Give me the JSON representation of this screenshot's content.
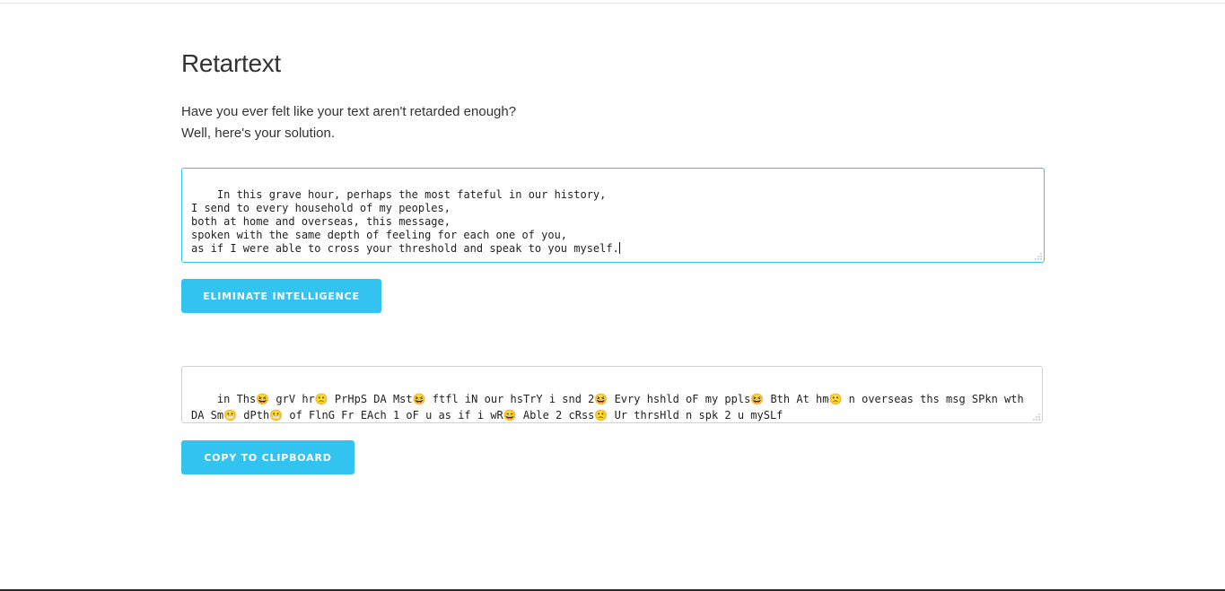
{
  "header": {
    "title": "Retartext",
    "tagline_1": "Have you ever felt like your text aren't retarded enough?",
    "tagline_2": "Well, here's your solution."
  },
  "input": {
    "value": "In this grave hour, perhaps the most fateful in our history,\nI send to every household of my peoples,\nboth at home and overseas, this message,\nspoken with the same depth of feeling for each one of you,\nas if I were able to cross your threshold and speak to you myself."
  },
  "buttons": {
    "eliminate_label": "ELIMINATE INTELLIGENCE",
    "copy_label": "COPY TO CLIPBOARD"
  },
  "output": {
    "value": "in Ths😆 grV hr🙁 PrHpS DA Mst😆 ftfl iN our hsTrY i snd 2😆 Evry hshld oF my ppls😆 Bth At hm🙁 n overseas ths msg SPkn wth DA Sm😬 dPth😬 of FlnG Fr EAch 1 oF u as if i wR😄 Able 2 cRss🙁 Ur thrsHld n spk 2 u mySLf"
  },
  "colors": {
    "accent": "#33c3f0",
    "text": "#333333",
    "border": "#d1d1d1"
  }
}
